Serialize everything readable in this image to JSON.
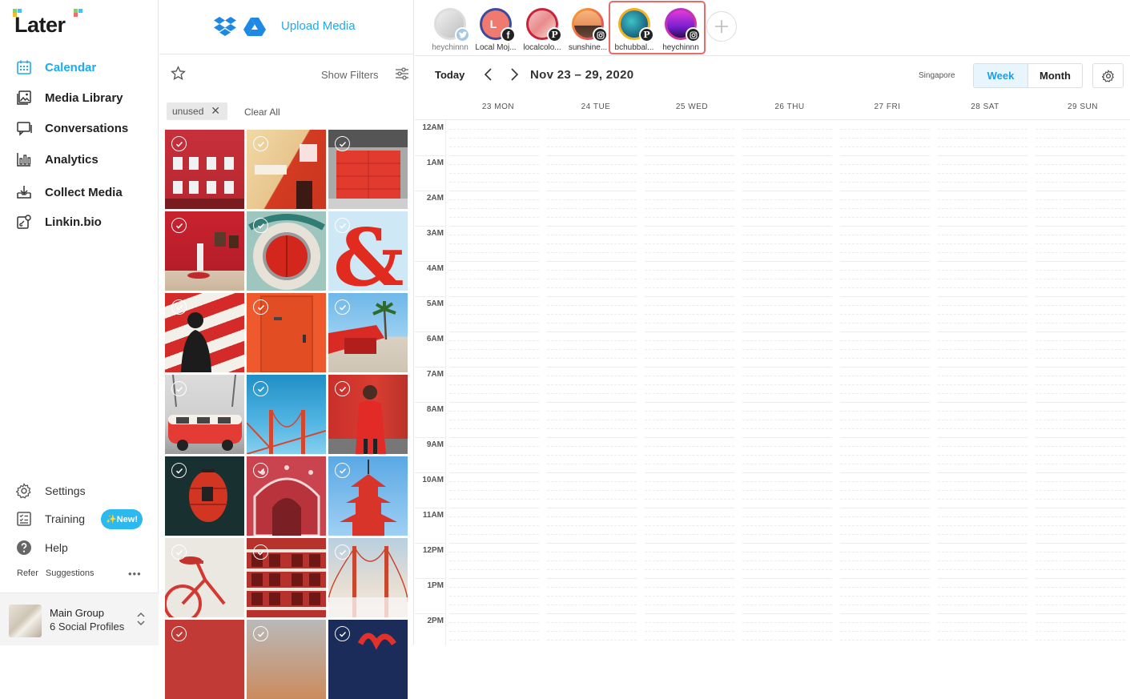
{
  "brand": {
    "name": "Later"
  },
  "nav": [
    {
      "label": "Calendar",
      "icon": "calendar-icon",
      "active": true
    },
    {
      "label": "Media Library",
      "icon": "image-icon",
      "active": false
    },
    {
      "label": "Conversations",
      "icon": "chat-icon",
      "active": false
    },
    {
      "label": "Analytics",
      "icon": "bar-chart-icon",
      "active": false
    },
    {
      "label": "Collect Media",
      "icon": "download-tray-icon",
      "active": false
    },
    {
      "label": "Linkin.bio",
      "icon": "link-bio-icon",
      "active": false
    }
  ],
  "bottom_nav": {
    "settings": "Settings",
    "training": "Training",
    "new_badge": "✨New!",
    "help": "Help",
    "refer": "Refer",
    "suggestions": "Suggestions"
  },
  "group": {
    "name": "Main Group",
    "profiles": "6 Social Profiles"
  },
  "media": {
    "upload_label": "Upload Media",
    "show_filters": "Show Filters",
    "chip": "unused",
    "clear_all": "Clear All",
    "tiles": [
      {
        "name": "red-building"
      },
      {
        "name": "red-door-sign"
      },
      {
        "name": "red-garage"
      },
      {
        "name": "red-gallery-room"
      },
      {
        "name": "round-red-door"
      },
      {
        "name": "red-ampersand"
      },
      {
        "name": "red-stripe-silhouette"
      },
      {
        "name": "orange-door"
      },
      {
        "name": "red-awning-palm"
      },
      {
        "name": "red-vw-bus"
      },
      {
        "name": "golden-gate-blue"
      },
      {
        "name": "red-coat-woman"
      },
      {
        "name": "red-lantern"
      },
      {
        "name": "red-temple-arch"
      },
      {
        "name": "red-pagoda"
      },
      {
        "name": "red-bicycle"
      },
      {
        "name": "red-apartment"
      },
      {
        "name": "golden-gate-fog"
      },
      {
        "name": "red-partial-1"
      },
      {
        "name": "red-partial-2"
      },
      {
        "name": "red-partial-3"
      }
    ]
  },
  "profiles": [
    {
      "name": "heychinnn",
      "network": "twitter",
      "dim": true
    },
    {
      "name": "Local Moj...",
      "network": "facebook",
      "dim": false
    },
    {
      "name": "localcolo...",
      "network": "pinterest",
      "dim": false
    },
    {
      "name": "sunshine...",
      "network": "instagram",
      "dim": false
    },
    {
      "name": "bchubbal...",
      "network": "pinterest",
      "dim": false
    },
    {
      "name": "heychinnn",
      "network": "instagram",
      "dim": false
    }
  ],
  "toolbar": {
    "today": "Today",
    "range": "Nov 23 – 29, 2020",
    "timezone": "Singapore",
    "week": "Week",
    "month": "Month"
  },
  "days": [
    "23 MON",
    "24 TUE",
    "25 WED",
    "26 THU",
    "27 FRI",
    "28 SAT",
    "29 SUN"
  ],
  "hours": [
    "12AM",
    "1AM",
    "2AM",
    "3AM",
    "4AM",
    "5AM",
    "6AM",
    "7AM",
    "8AM",
    "9AM",
    "10AM",
    "11AM",
    "12PM",
    "1PM",
    "2PM"
  ],
  "colors": {
    "accent": "#1eaaf1",
    "highlight": "#e96a6a"
  }
}
